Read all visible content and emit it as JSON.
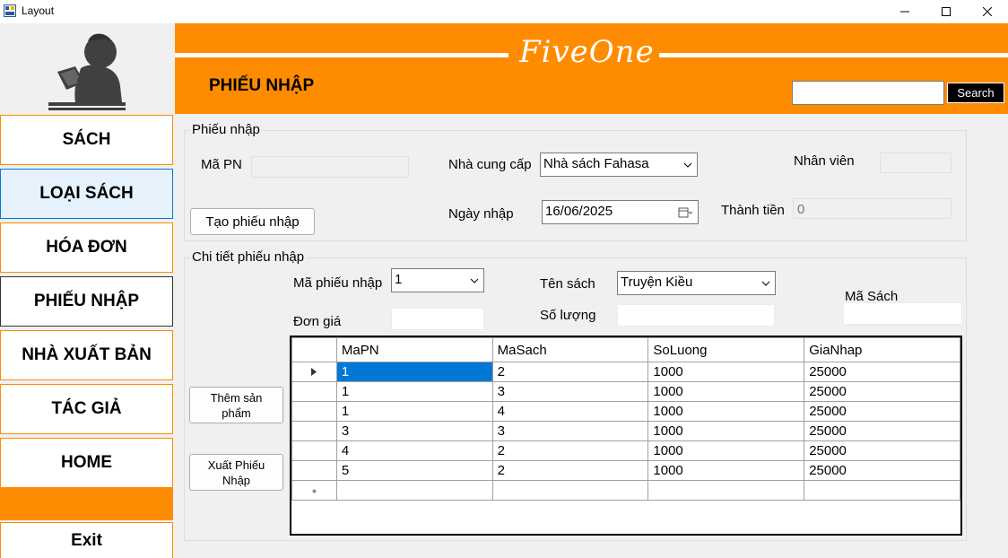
{
  "window": {
    "title": "Layout"
  },
  "sidebar": {
    "items": [
      {
        "label": "SÁCH"
      },
      {
        "label": "LOẠI SÁCH"
      },
      {
        "label": "HÓA ĐƠN"
      },
      {
        "label": "PHIẾU NHẬP"
      },
      {
        "label": "NHÀ XUẤT BẢN"
      },
      {
        "label": "TÁC GIẢ"
      },
      {
        "label": "HOME"
      },
      {
        "label": "Exit"
      }
    ]
  },
  "header": {
    "brand": "FiveOne",
    "title": "PHIẾU NHẬP",
    "search_button": "Search",
    "search_value": ""
  },
  "phieu_nhap_group": {
    "title": "Phiếu nhập",
    "ma_pn_label": "Mã PN",
    "ma_pn_value": "",
    "nha_cung_cap_label": "Nhà cung cấp",
    "nha_cung_cap_value": "Nhà sách Fahasa",
    "nhan_vien_label": "Nhân viên",
    "tao_button": "Tạo phiếu nhập",
    "ngay_nhap_label": "Ngày nhập",
    "ngay_nhap_value": "16/06/2025",
    "thanh_tien_label": "Thành tiền",
    "thanh_tien_value": "0"
  },
  "chi_tiet_group": {
    "title": "Chi tiết phiếu nhập",
    "ma_phieu_nhap_label": "Mã phiếu nhập",
    "ma_phieu_nhap_value": "1",
    "ten_sach_label": "Tên sách",
    "ten_sach_value": "Truyện Kiều",
    "ma_sach_label": "Mã Sách",
    "don_gia_label": "Đơn giá",
    "so_luong_label": "Số lượng",
    "them_button": "Thêm sản phẩm",
    "xuat_button": "Xuất Phiếu Nhập"
  },
  "grid": {
    "columns": [
      "MaPN",
      "MaSach",
      "SoLuong",
      "GiaNhap"
    ],
    "rows": [
      [
        "1",
        "2",
        "1000",
        "25000"
      ],
      [
        "1",
        "3",
        "1000",
        "25000"
      ],
      [
        "1",
        "4",
        "1000",
        "25000"
      ],
      [
        "3",
        "3",
        "1000",
        "25000"
      ],
      [
        "4",
        "2",
        "1000",
        "25000"
      ],
      [
        "5",
        "2",
        "1000",
        "25000"
      ]
    ]
  },
  "colors": {
    "accent": "#ff8c00",
    "selection": "#0078d7"
  }
}
